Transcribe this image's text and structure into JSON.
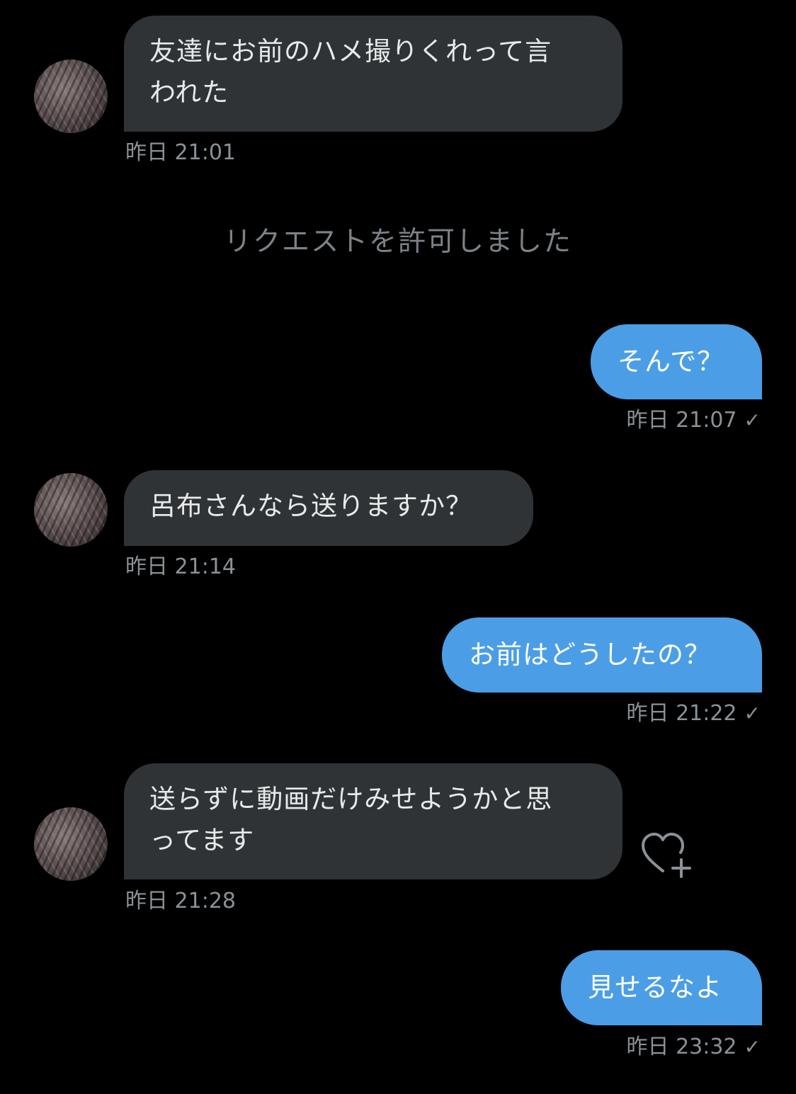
{
  "messages": [
    {
      "direction": "incoming",
      "text": "友達にお前のハメ撮りくれって言\nわれた",
      "time": "昨日 21:01"
    },
    {
      "direction": "system",
      "text": "リクエストを許可しました"
    },
    {
      "direction": "outgoing",
      "text": "そんで？",
      "time": "昨日 21:07"
    },
    {
      "direction": "incoming",
      "text": "呂布さんなら送りますか？",
      "time": "昨日 21:14"
    },
    {
      "direction": "outgoing",
      "text": "お前はどうしたの？",
      "time": "昨日 21:22"
    },
    {
      "direction": "incoming",
      "text": "送らずに動画だけみせようかと思\nってます",
      "time": "昨日 21:28"
    },
    {
      "direction": "outgoing",
      "text": "見せるなよ",
      "time": "昨日 23:32"
    }
  ],
  "read_indicator": "✓",
  "icons": {
    "avatar": "user-avatar",
    "like": "heart-plus-icon",
    "read": "checkmark-icon"
  },
  "colors": {
    "background": "#000000",
    "incoming_bubble": "#2f3336",
    "outgoing_bubble": "#4b9ee6",
    "meta_text": "#8b9196"
  }
}
